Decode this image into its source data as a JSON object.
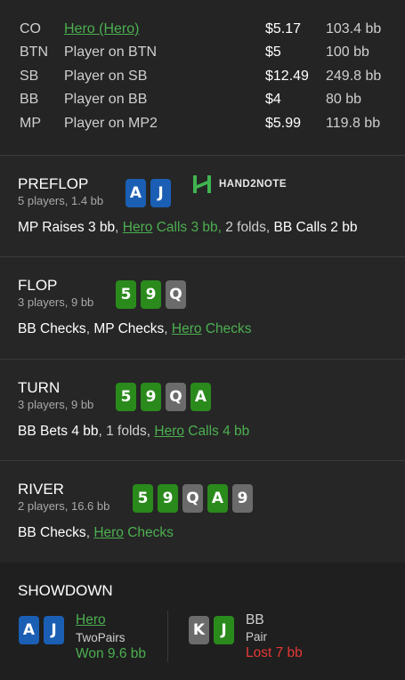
{
  "players": [
    {
      "pos": "CO",
      "name": "Hero (Hero)",
      "hero": true,
      "amount": "$5.17",
      "bb": "103.4 bb"
    },
    {
      "pos": "BTN",
      "name": "Player on BTN",
      "hero": false,
      "amount": "$5",
      "bb": "100 bb"
    },
    {
      "pos": "SB",
      "name": "Player on SB",
      "hero": false,
      "amount": "$12.49",
      "bb": "249.8 bb"
    },
    {
      "pos": "BB",
      "name": "Player on BB",
      "hero": false,
      "amount": "$4",
      "bb": "80 bb"
    },
    {
      "pos": "MP",
      "name": "Player on MP2",
      "hero": false,
      "amount": "$5.99",
      "bb": "119.8 bb"
    }
  ],
  "logo": {
    "text": "HAND2NOTE"
  },
  "preflop": {
    "title": "PREFLOP",
    "subtitle": "5 players, 1.4 bb",
    "cards": [
      {
        "rank": "A",
        "color": "blue"
      },
      {
        "rank": "J",
        "color": "blue"
      }
    ],
    "actions": {
      "a1_actor": "MP",
      "a1_action": " Raises 3 bb",
      "sep1": ", ",
      "a2_actor": "Hero",
      "a2_action": " Calls 3 bb,",
      "a3": " 2 folds, ",
      "a4_actor": "BB",
      "a4_action": " Calls 2 bb"
    }
  },
  "flop": {
    "title": "FLOP",
    "subtitle": "3 players, 9 bb",
    "cards": [
      {
        "rank": "5",
        "color": "green"
      },
      {
        "rank": "9",
        "color": "green"
      },
      {
        "rank": "Q",
        "color": "grey"
      }
    ],
    "actions": {
      "a1_actor": "BB",
      "a1_action": " Checks",
      "sep1": ", ",
      "a2_actor": "MP",
      "a2_action": " Checks",
      "sep2": ", ",
      "a3_actor": "Hero",
      "a3_action": " Checks"
    }
  },
  "turn": {
    "title": "TURN",
    "subtitle": "3 players, 9 bb",
    "cards": [
      {
        "rank": "5",
        "color": "green"
      },
      {
        "rank": "9",
        "color": "green"
      },
      {
        "rank": "Q",
        "color": "grey"
      },
      {
        "rank": "A",
        "color": "green"
      }
    ],
    "actions": {
      "a1_actor": "BB",
      "a1_action": " Bets 4 bb",
      "sep1": ", 1 folds, ",
      "a2_actor": "Hero",
      "a2_action": " Calls 4 bb"
    }
  },
  "river": {
    "title": "RIVER",
    "subtitle": "2 players, 16.6 bb",
    "cards": [
      {
        "rank": "5",
        "color": "green"
      },
      {
        "rank": "9",
        "color": "green"
      },
      {
        "rank": "Q",
        "color": "grey"
      },
      {
        "rank": "A",
        "color": "green"
      },
      {
        "rank": "9",
        "color": "grey"
      }
    ],
    "actions": {
      "a1_actor": "BB",
      "a1_action": " Checks",
      "sep1": ", ",
      "a2_actor": "Hero",
      "a2_action": " Checks"
    }
  },
  "showdown": {
    "title": "SHOWDOWN",
    "left": {
      "cards": [
        {
          "rank": "A",
          "color": "blue"
        },
        {
          "rank": "J",
          "color": "blue"
        }
      ],
      "name": "Hero",
      "hand": "TwoPairs",
      "result": "Won 9.6 bb"
    },
    "right": {
      "cards": [
        {
          "rank": "K",
          "color": "grey"
        },
        {
          "rank": "J",
          "color": "green"
        }
      ],
      "name": "BB",
      "hand": "Pair",
      "result": "Lost 7 bb"
    }
  },
  "colors": {
    "hero": "#4caf50",
    "won": "#4caf50",
    "lost": "#e53935",
    "card_blue": "#1a5fb4",
    "card_green": "#2a8a1c",
    "card_grey": "#6b6b6b"
  }
}
